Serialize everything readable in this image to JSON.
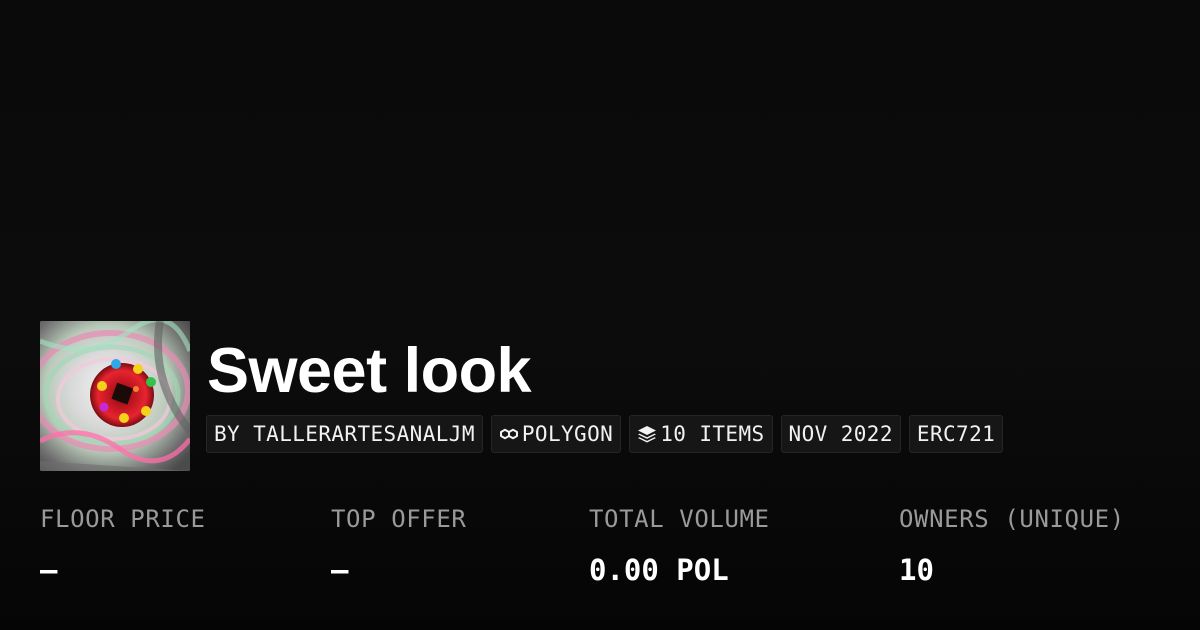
{
  "collection": {
    "name": "Sweet look",
    "image_icon": "donut-eye-artwork"
  },
  "meta_chips": [
    {
      "label": "BY TALLERARTESANALJM",
      "icon": null
    },
    {
      "label": "POLYGON",
      "icon": "polygon-chain-icon"
    },
    {
      "label": "10 ITEMS",
      "icon": "layers-icon"
    },
    {
      "label": "NOV 2022",
      "icon": null
    },
    {
      "label": "ERC721",
      "icon": null
    }
  ],
  "stats": [
    {
      "label": "FLOOR PRICE",
      "value": "–"
    },
    {
      "label": "TOP OFFER",
      "value": "–"
    },
    {
      "label": "TOTAL VOLUME",
      "value": "0.00 POL"
    },
    {
      "label": "OWNERS (UNIQUE)",
      "value": "10"
    }
  ],
  "colors": {
    "background": "#0b0b0b",
    "chip_background": "#161616",
    "label_gray": "#9a9a9a",
    "text": "#ffffff"
  }
}
